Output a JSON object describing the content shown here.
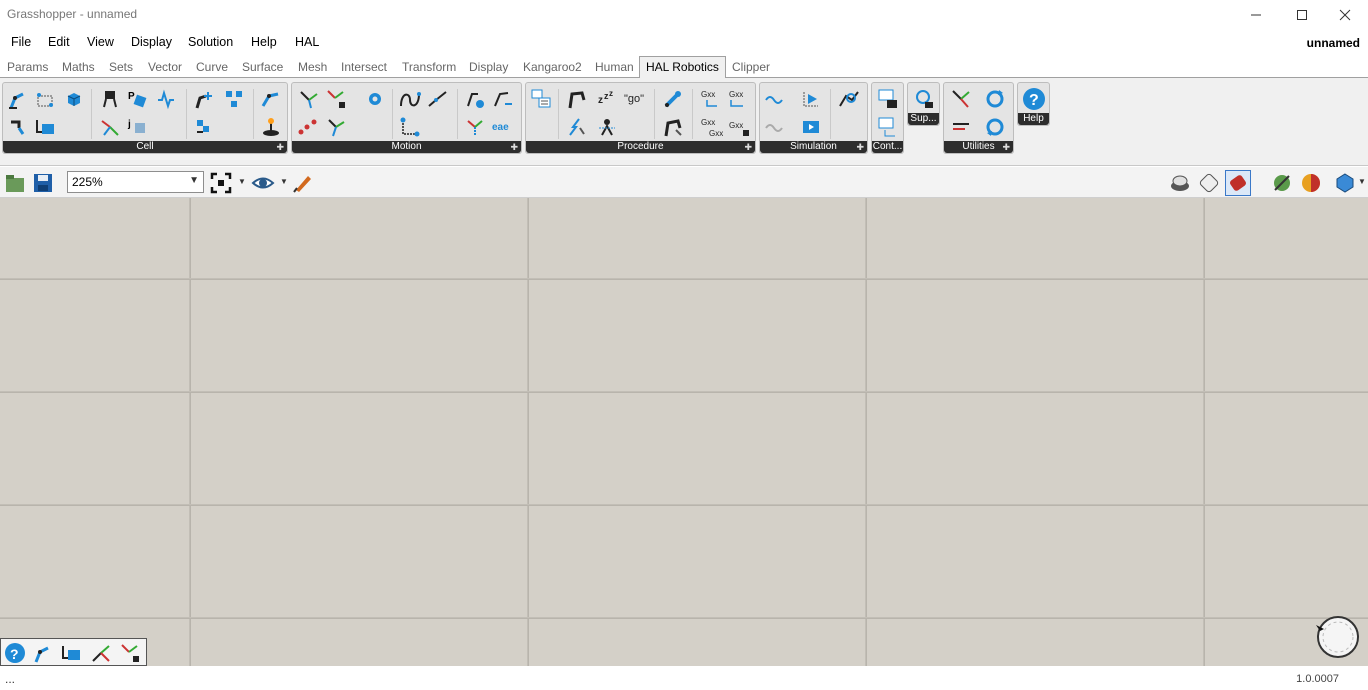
{
  "window": {
    "title": "Grasshopper - unnamed",
    "controls": [
      "minimize-icon",
      "maximize-icon",
      "close-icon"
    ]
  },
  "menubar": {
    "items": [
      "File",
      "Edit",
      "View",
      "Display",
      "Solution",
      "Help",
      "HAL"
    ],
    "document_name": "unnamed"
  },
  "tabs": {
    "items": [
      "Params",
      "Maths",
      "Sets",
      "Vector",
      "Curve",
      "Surface",
      "Mesh",
      "Intersect",
      "Transform",
      "Display",
      "Kangaroo2",
      "Human",
      "HAL Robotics",
      "Clipper"
    ],
    "active": "HAL Robotics"
  },
  "ribbon": {
    "panels": [
      "Cell",
      "Motion",
      "Procedure",
      "Simulation",
      "Cont...",
      "Sup...",
      "Utilities",
      "Help"
    ]
  },
  "canvas_toolbar": {
    "zoom_value": "225%"
  },
  "colors": {
    "canvas_bg": "#d4d0c8",
    "grid_line": "#c2beb6",
    "accent_blue": "#1f8ad6"
  },
  "status": {
    "left_text": "...",
    "version": "1.0.0007"
  }
}
